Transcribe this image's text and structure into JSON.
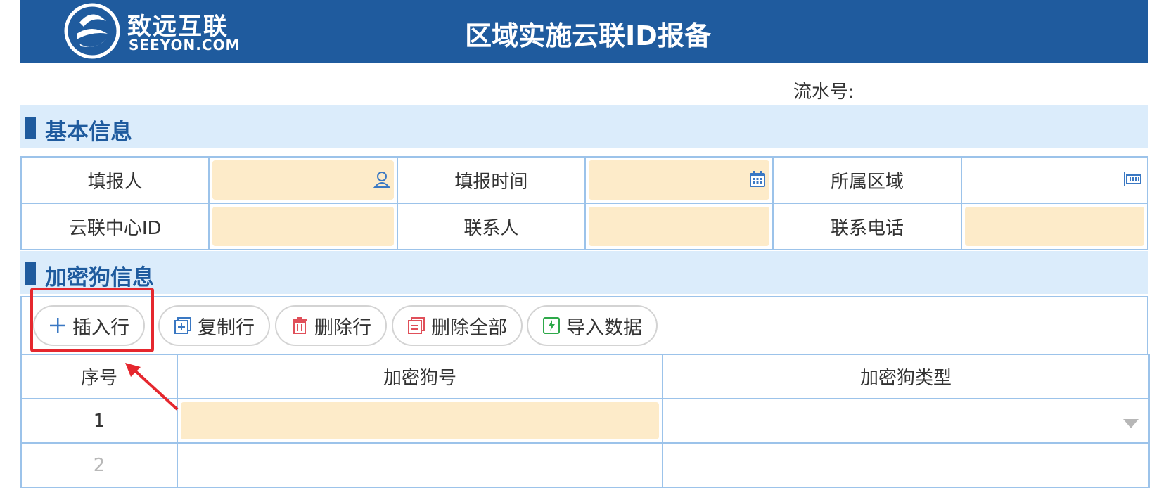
{
  "header": {
    "logo_cn": "致远互联",
    "logo_en": "SEEYON.COM",
    "title": "区域实施云联ID报备"
  },
  "serial_label": "流水号:",
  "basic_info": {
    "section_title": "基本信息",
    "row1": [
      {
        "label": "填报人",
        "field_icon": "person-icon"
      },
      {
        "label": "填报时间",
        "field_icon": "calendar-icon"
      },
      {
        "label": "所属区域",
        "field_icon": "selector-icon"
      }
    ],
    "row2": [
      {
        "label": "云联中心ID"
      },
      {
        "label": "联系人"
      },
      {
        "label": "联系电话"
      }
    ]
  },
  "dongle_info": {
    "section_title": "加密狗信息",
    "toolbar": {
      "insert_row": "插入行",
      "copy_row": "复制行",
      "delete_row": "删除行",
      "delete_all": "删除全部",
      "import_data": "导入数据"
    },
    "columns": [
      "序号",
      "加密狗号",
      "加密狗类型"
    ],
    "rows": [
      {
        "index": "1"
      },
      {
        "index": "2"
      }
    ]
  },
  "colors": {
    "brand": "#1f5b9e",
    "section_bg": "#dbecfb",
    "field_fill": "#fdebc9",
    "highlight": "#e5272e"
  }
}
